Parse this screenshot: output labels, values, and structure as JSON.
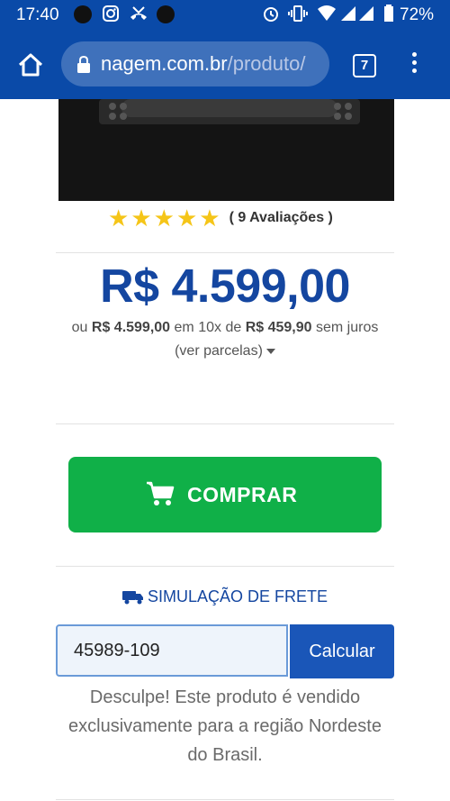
{
  "status_bar": {
    "time": "17:40",
    "battery": "72%",
    "icons": [
      "instagram-icon",
      "missed-call-icon",
      "alarm-icon",
      "vibrate-icon",
      "wifi-icon",
      "signal-icon",
      "battery-icon"
    ]
  },
  "browser": {
    "url_domain": "nagem.com.br",
    "url_path": "/produto/",
    "tab_count": "7",
    "bar_color": "#0a4aa8"
  },
  "product": {
    "rating_stars": 5,
    "reviews_label": "( 9 Avaliações )",
    "price": "R$ 4.599,00",
    "installments": {
      "prefix": "ou",
      "total": "R$ 4.599,00",
      "middle": "em 10x de",
      "per_installment": "R$ 459,90",
      "suffix": "sem juros"
    },
    "see_installments": "(ver parcelas)",
    "price_color": "#1446a0"
  },
  "buy_button": {
    "label": "COMPRAR",
    "color": "#10b048"
  },
  "shipping": {
    "title": "SIMULAÇÃO DE FRETE",
    "cep_value": "45989-109",
    "calculate_label": "Calcular",
    "message": "Desculpe! Este produto é vendido exclusivamente para a região Nordeste do Brasil."
  }
}
